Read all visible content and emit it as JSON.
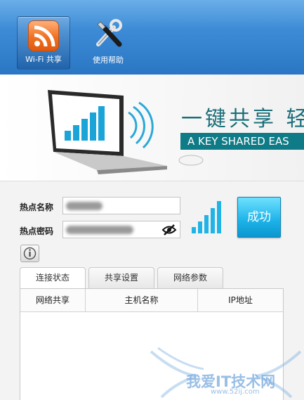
{
  "toolbar": {
    "wifi_share_label": "Wi-Fi 共享",
    "help_label": "使用帮助"
  },
  "banner": {
    "slogan_cn": "一键共享 轻",
    "slogan_en": "A KEY SHARED EAS"
  },
  "form": {
    "ssid_label": "热点名称",
    "password_label": "热点密码",
    "success_label": "成功"
  },
  "tabs": [
    "连接状态",
    "共享设置",
    "网络参数"
  ],
  "table": {
    "columns": [
      "网络共享",
      "主机名称",
      "IP地址"
    ]
  },
  "watermark": {
    "text": "我爱IT技术网",
    "url": "www.52ij.com"
  },
  "colors": {
    "toolbar": "#2a76c4",
    "accent": "#0f7b86",
    "success": "#1bb2e8"
  }
}
